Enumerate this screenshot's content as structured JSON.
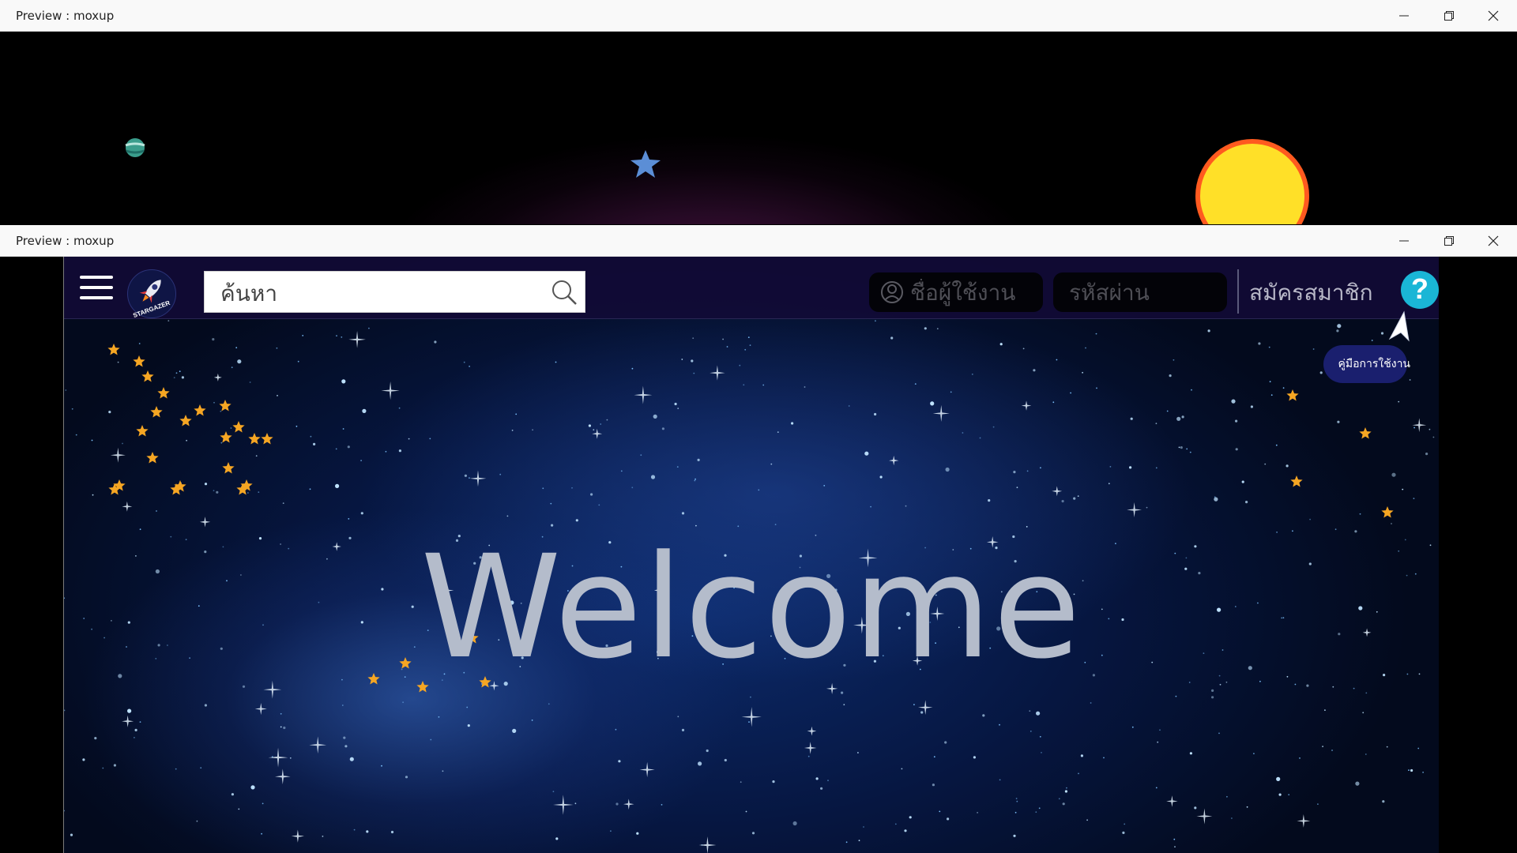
{
  "windows": [
    {
      "title": "Preview : moxup"
    },
    {
      "title": "Preview : moxup"
    }
  ],
  "controls": {
    "minimize": "minimize-icon",
    "restore": "restore-icon",
    "close": "close-icon"
  },
  "back_scene": {
    "planet": "planet-icon",
    "star": "star-icon",
    "sun": "sun-icon"
  },
  "app": {
    "brand": "STARGAZER",
    "search": {
      "placeholder": "ค้นหา"
    },
    "login": {
      "username_placeholder": "ชื่อผู้ใช้งาน",
      "password_placeholder": "รหัสผ่าน"
    },
    "register_label": "สมัครสมาชิก",
    "help_label": "?",
    "manual_label": "คู่มือการใช้งาน",
    "welcome": "Welcome"
  },
  "colors": {
    "accent_help": "#1ab6d6",
    "manual_button": "#1a1f6e",
    "star_gold": "#f6a623",
    "sun": "#ffe028"
  }
}
